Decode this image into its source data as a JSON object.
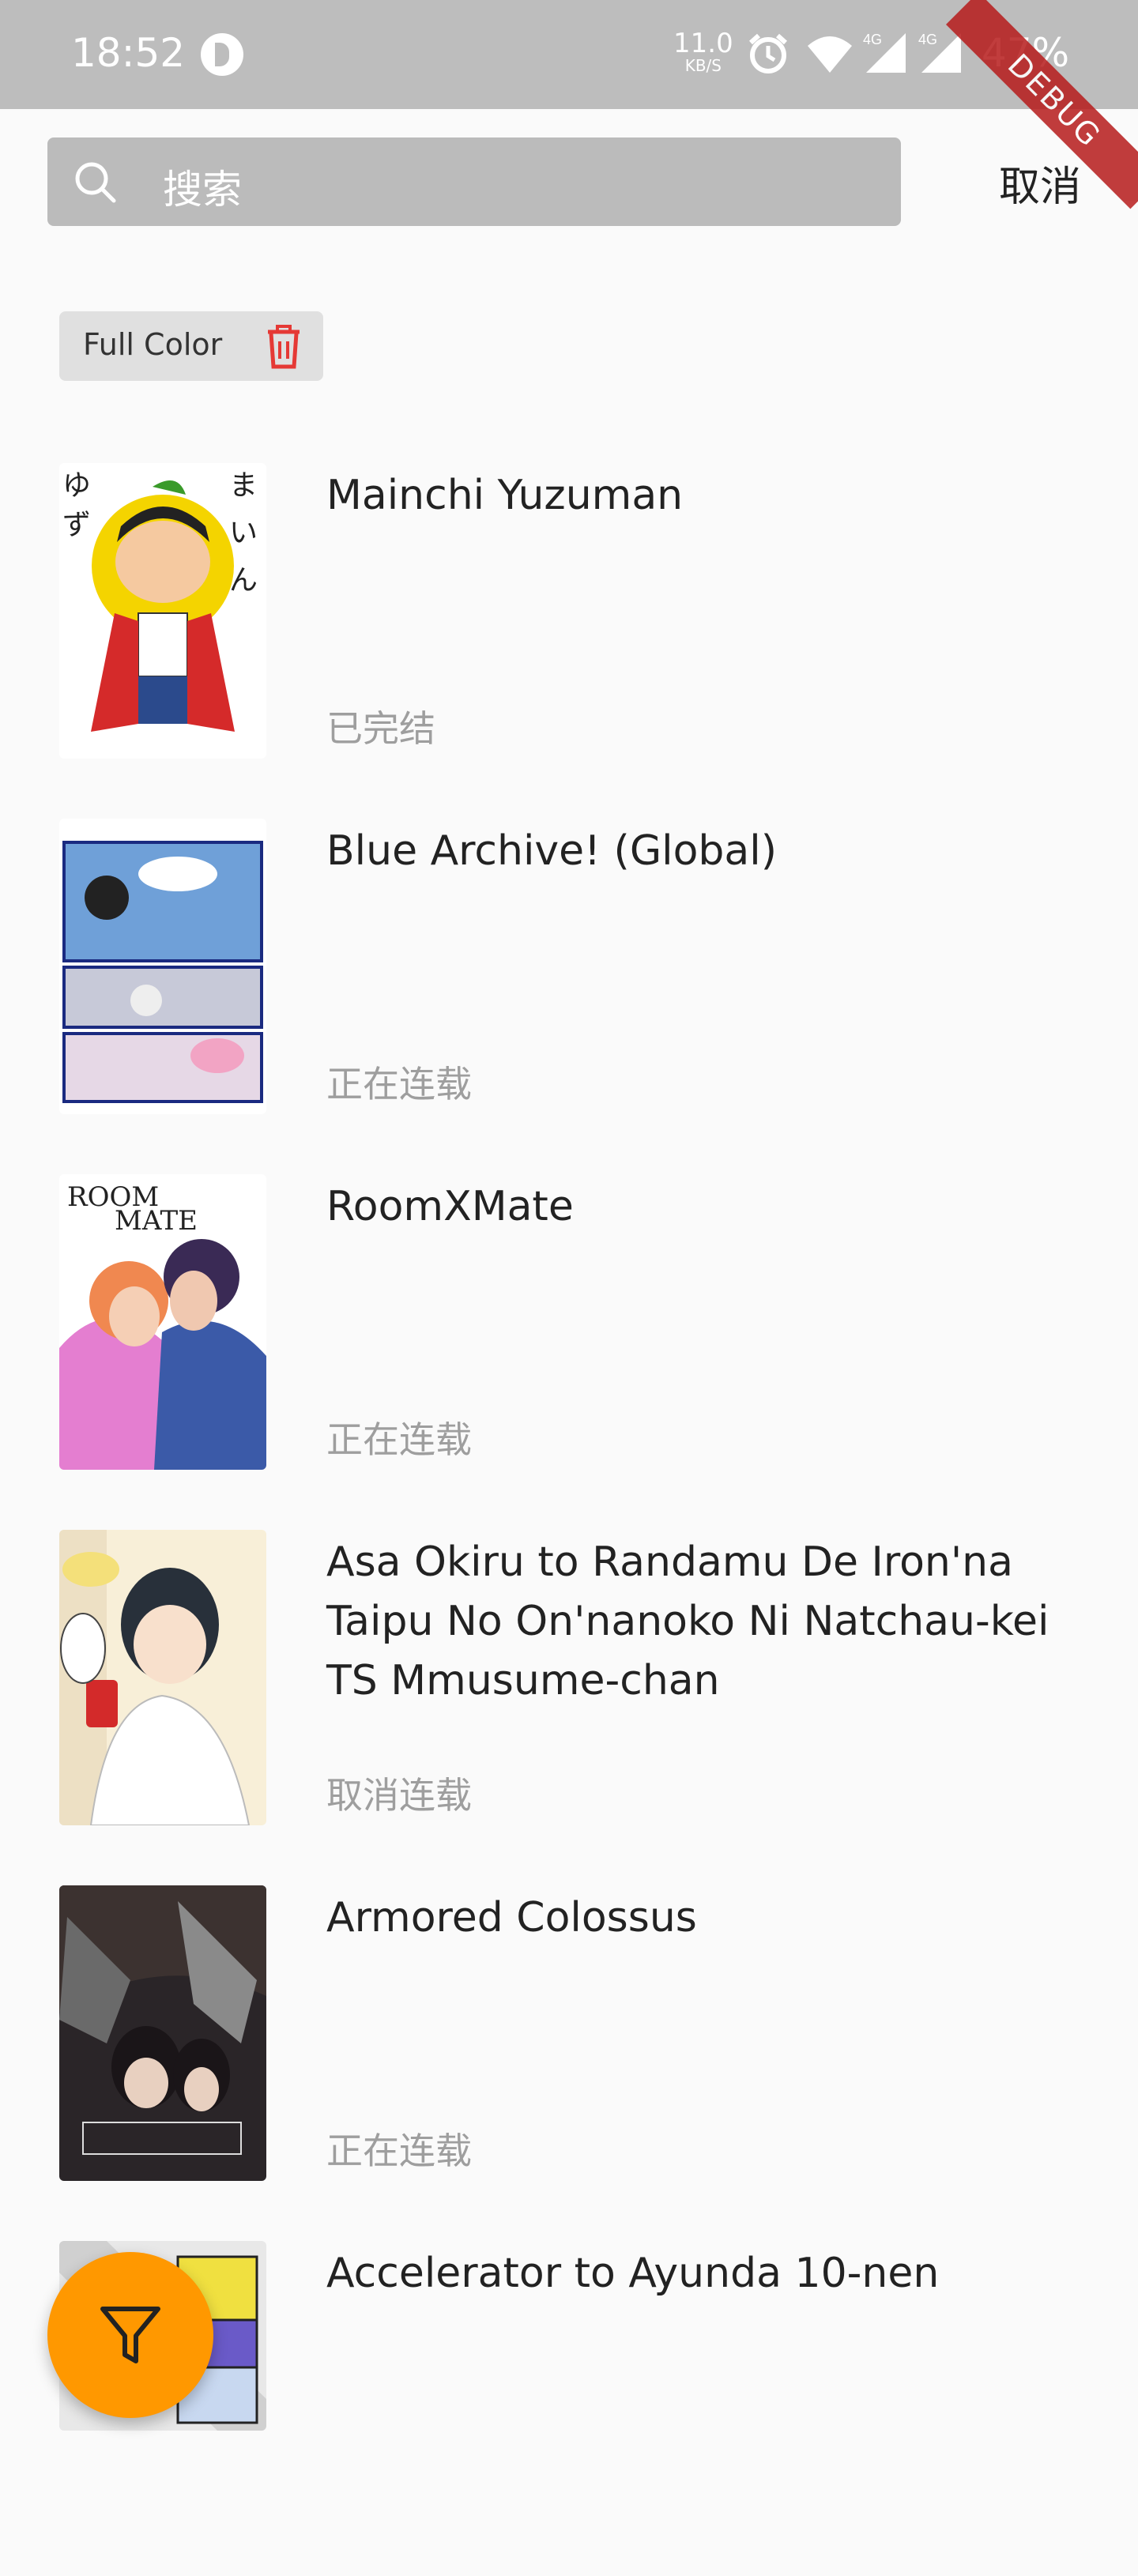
{
  "status_bar": {
    "time": "18:52",
    "net_speed_value": "11.0",
    "net_speed_unit": "KB/S",
    "battery": "47%",
    "debug_banner": "DEBUG"
  },
  "search": {
    "placeholder": "搜索",
    "cancel_label": "取消"
  },
  "filter_chip": {
    "label": "Full Color"
  },
  "comics": [
    {
      "title": "Mainchi Yuzuman",
      "status": "已完结"
    },
    {
      "title": "Blue Archive! (Global)",
      "status": "正在连载"
    },
    {
      "title": "RoomXMate",
      "status": "正在连载"
    },
    {
      "title": "Asa Okiru to Randamu De Iron'na Taipu No On'nanoko Ni Natchau-kei TS Mmusume-chan",
      "status": "取消连载"
    },
    {
      "title": "Armored Colossus",
      "status": "正在连载"
    },
    {
      "title": "Accelerator to Ayunda 10-nen",
      "status": ""
    }
  ],
  "colors": {
    "status_bar": "#bdbdbd",
    "search_box": "#bbbbbb",
    "fab": "#ff9800",
    "trash_icon": "#e53935",
    "debug_banner": "#b71c1c"
  }
}
